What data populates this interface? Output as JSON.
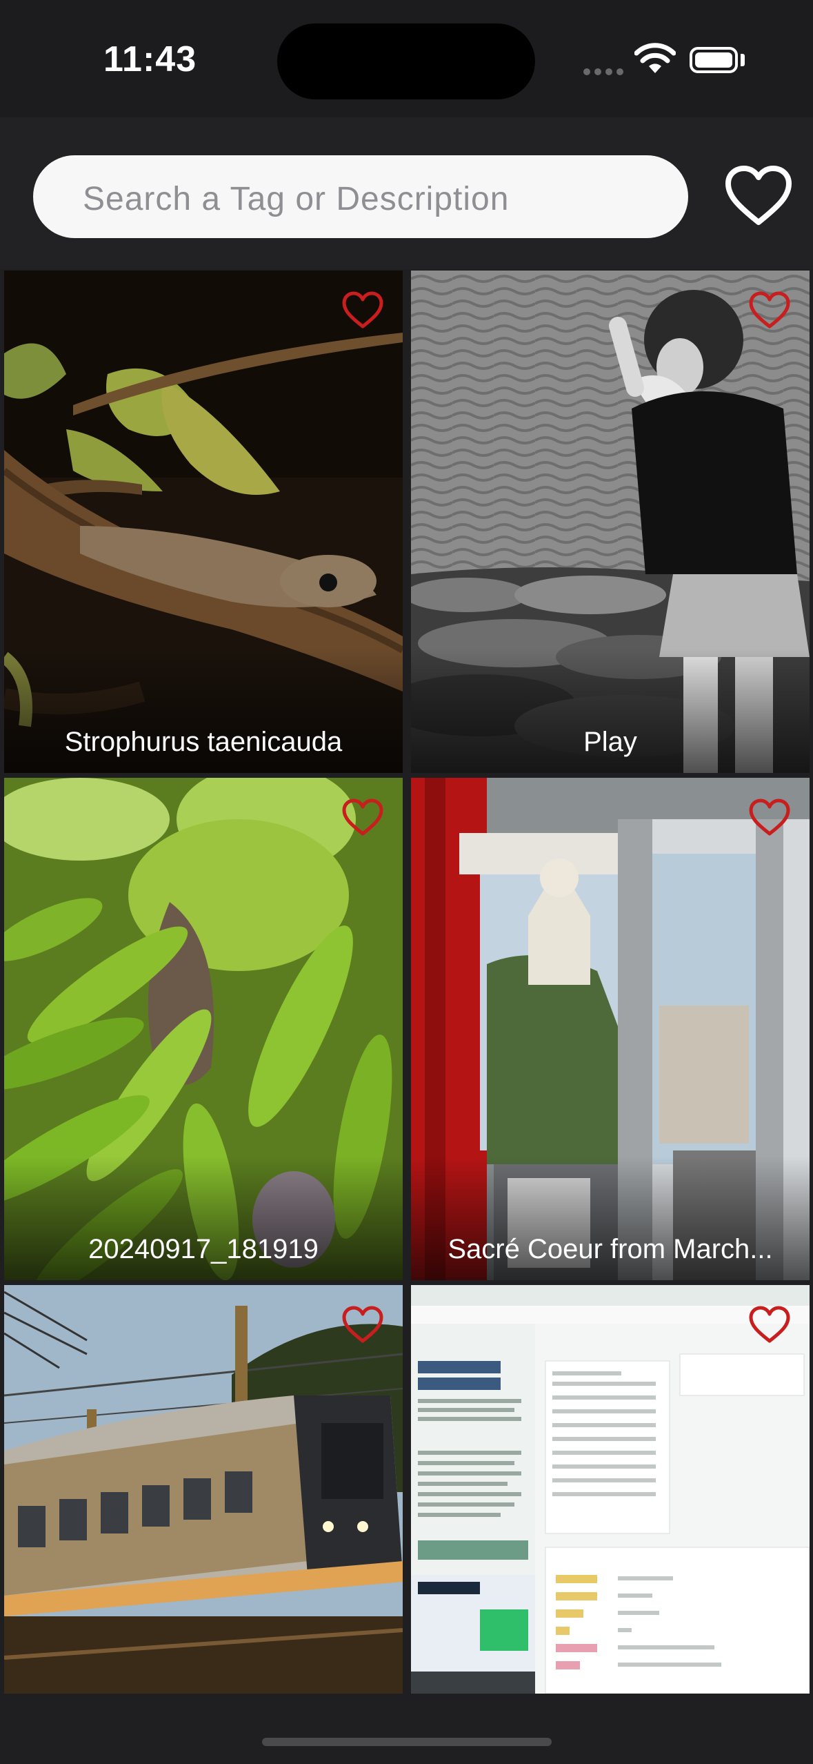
{
  "status": {
    "time": "11:43"
  },
  "search": {
    "placeholder": "Search a Tag or Description"
  },
  "accent": {
    "heart": "#c81e1e",
    "filter_heart": "#ffffff"
  },
  "photos": [
    {
      "caption": "Strophurus taenicauda",
      "favorite": false,
      "heart_icon": "heart-outline-icon"
    },
    {
      "caption": "Play",
      "favorite": false,
      "heart_icon": "heart-outline-icon"
    },
    {
      "caption": "20240917_181919",
      "favorite": false,
      "heart_icon": "heart-outline-icon"
    },
    {
      "caption": "Sacré Coeur from March...",
      "favorite": false,
      "heart_icon": "heart-outline-icon"
    },
    {
      "caption": "",
      "favorite": false,
      "heart_icon": "heart-outline-icon"
    },
    {
      "caption": "",
      "favorite": false,
      "heart_icon": "heart-outline-icon"
    }
  ]
}
